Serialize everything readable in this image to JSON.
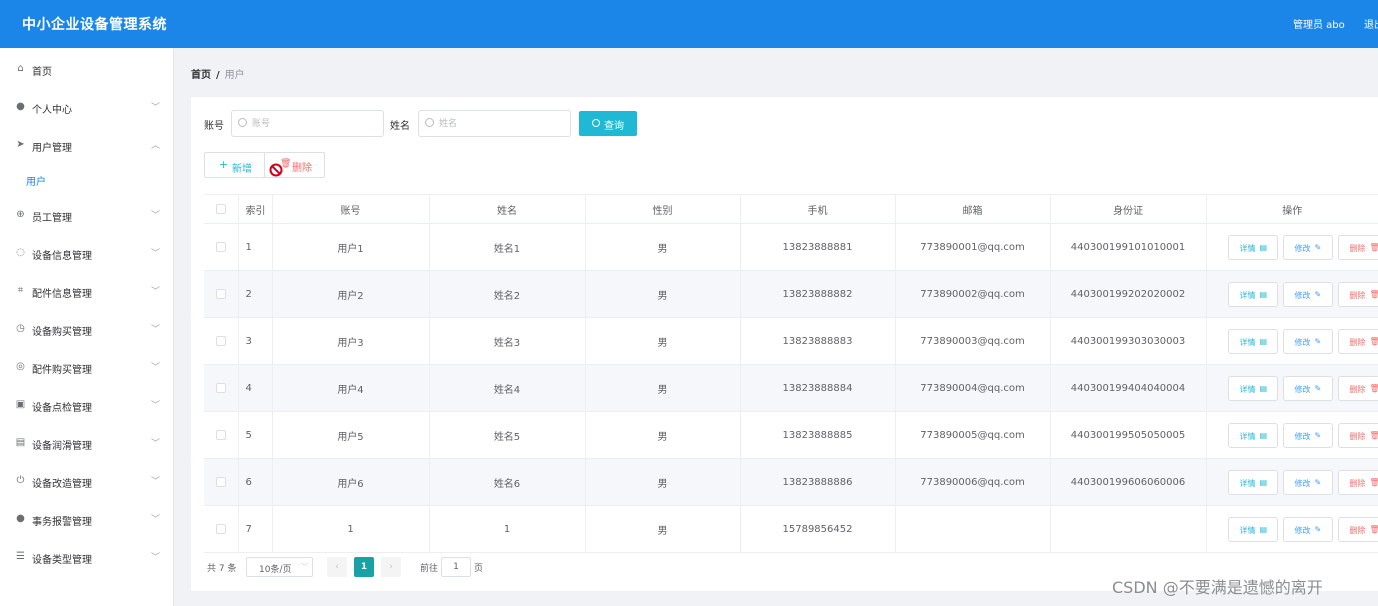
{
  "header": {
    "title": "中小企业设备管理系统",
    "admin": "管理员 abo",
    "logout": "退出"
  },
  "sidebar": {
    "items": [
      {
        "label": "首页",
        "icon": "home-icon",
        "glyph": "⌂",
        "chevron": ""
      },
      {
        "label": "个人中心",
        "icon": "user-icon",
        "glyph": "●",
        "chevron": "﹀"
      },
      {
        "label": "用户管理",
        "icon": "send-icon",
        "glyph": "➤",
        "chevron": "︿"
      },
      {
        "label": "员工管理",
        "icon": "target-icon",
        "glyph": "⊕",
        "chevron": "﹀"
      },
      {
        "label": "设备信息管理",
        "icon": "bulb-icon",
        "glyph": "◌",
        "chevron": "﹀"
      },
      {
        "label": "配件信息管理",
        "icon": "crop-icon",
        "glyph": "⌗",
        "chevron": "﹀"
      },
      {
        "label": "设备购买管理",
        "icon": "clock-icon",
        "glyph": "◷",
        "chevron": "﹀"
      },
      {
        "label": "配件购买管理",
        "icon": "circle-icon",
        "glyph": "◎",
        "chevron": "﹀"
      },
      {
        "label": "设备点检管理",
        "icon": "clipboard-icon",
        "glyph": "▣",
        "chevron": "﹀"
      },
      {
        "label": "设备润滑管理",
        "icon": "chart-icon",
        "glyph": "▤",
        "chevron": "﹀"
      },
      {
        "label": "设备改造管理",
        "icon": "power-icon",
        "glyph": "⏻",
        "chevron": "﹀"
      },
      {
        "label": "事务报警管理",
        "icon": "user-icon",
        "glyph": "●",
        "chevron": "﹀"
      },
      {
        "label": "设备类型管理",
        "icon": "menu-icon",
        "glyph": "☰",
        "chevron": "﹀"
      }
    ],
    "sub_item": "用户"
  },
  "breadcrumb": {
    "home": "首页",
    "sep": "/",
    "current": "用户"
  },
  "filters": {
    "account_label": "账号",
    "account_placeholder": "账号",
    "name_label": "姓名",
    "name_placeholder": "姓名",
    "query_label": "查询"
  },
  "actions": {
    "add_label": "新增",
    "delete_label": "删除"
  },
  "table": {
    "headers": [
      "",
      "索引",
      "账号",
      "姓名",
      "性别",
      "手机",
      "邮箱",
      "身份证",
      "操作"
    ],
    "rows": [
      [
        "1",
        "用户1",
        "姓名1",
        "男",
        "13823888881",
        "773890001@qq.com",
        "440300199101010001"
      ],
      [
        "2",
        "用户2",
        "姓名2",
        "男",
        "13823888882",
        "773890002@qq.com",
        "440300199202020002"
      ],
      [
        "3",
        "用户3",
        "姓名3",
        "男",
        "13823888883",
        "773890003@qq.com",
        "440300199303030003"
      ],
      [
        "4",
        "用户4",
        "姓名4",
        "男",
        "13823888884",
        "773890004@qq.com",
        "440300199404040004"
      ],
      [
        "5",
        "用户5",
        "姓名5",
        "男",
        "13823888885",
        "773890005@qq.com",
        "440300199505050005"
      ],
      [
        "6",
        "用户6",
        "姓名6",
        "男",
        "13823888886",
        "773890006@qq.com",
        "440300199606060006"
      ],
      [
        "7",
        "1",
        "1",
        "男",
        "15789856452",
        "",
        ""
      ]
    ],
    "op_labels": {
      "detail": "详情",
      "edit": "修改",
      "delete": "删除"
    }
  },
  "pagination": {
    "total": "共 7 条",
    "page_size": "10条/页",
    "current_page": "1",
    "goto_label": "前往",
    "goto_value": "1",
    "page_suffix": "页"
  },
  "watermark": "CSDN @不要满是遗憾的离开"
}
